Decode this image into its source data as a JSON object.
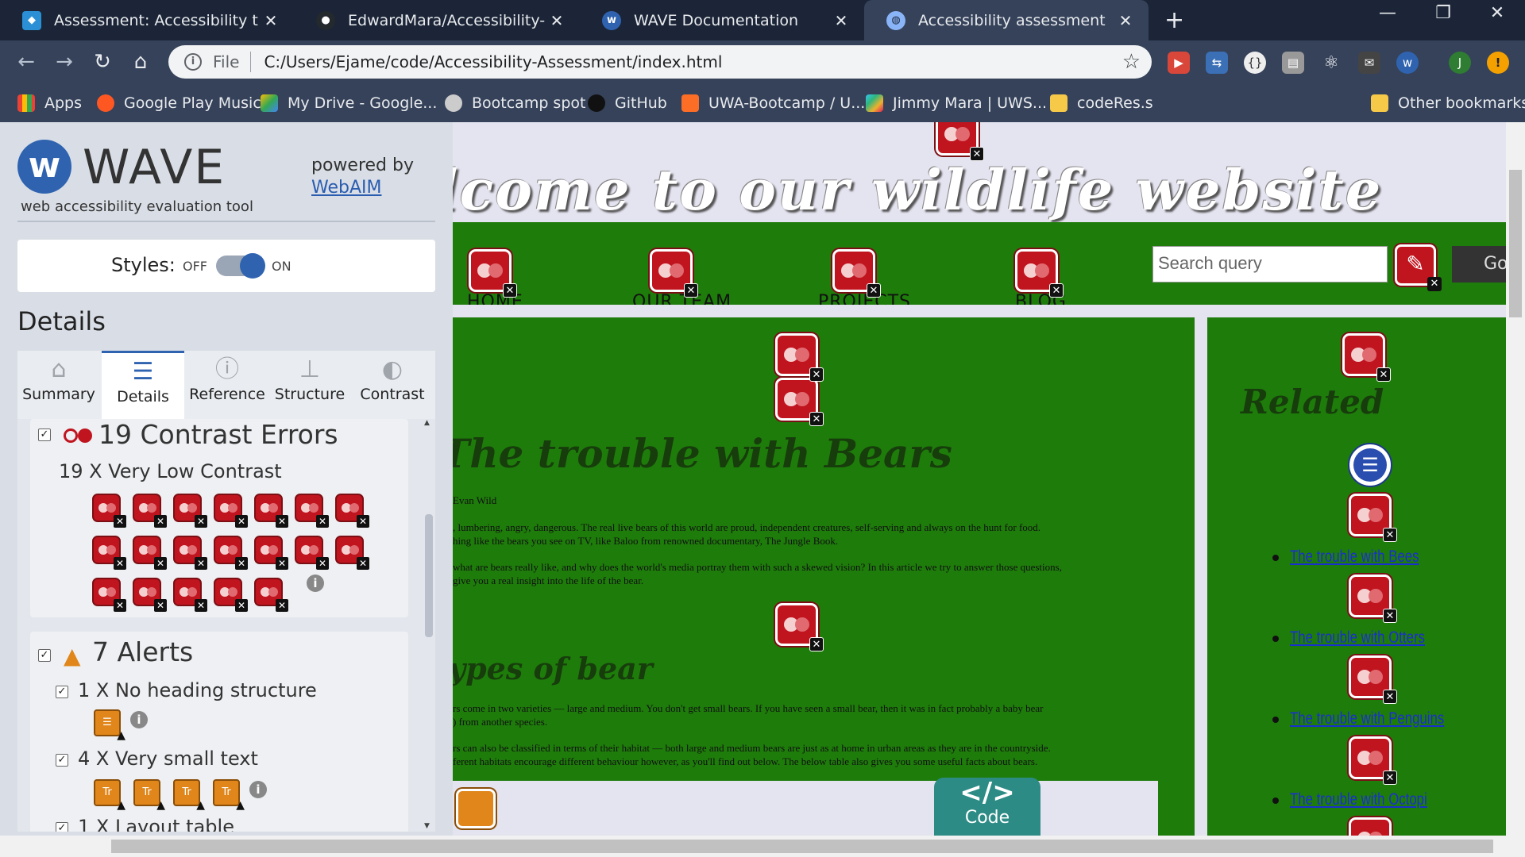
{
  "browser": {
    "tabs": [
      {
        "title": "Assessment: Accessibility trouble",
        "icon": "mdn-favicon",
        "color": "#2b8fd6"
      },
      {
        "title": "EdwardMara/Accessibility-Assess",
        "icon": "github-favicon",
        "color": "#24292e"
      },
      {
        "title": "WAVE Documentation",
        "icon": "wave-favicon",
        "color": "#2f63b0"
      },
      {
        "title": "Accessibility assessment",
        "icon": "globe-favicon",
        "color": "#8ab4f8"
      }
    ],
    "address": {
      "scheme_label": "File",
      "url": "C:/Users/Ejame/code/Accessibility-Assessment/index.html"
    },
    "profile_initial": "J",
    "bookmarks": [
      "Apps",
      "Google Play Music",
      "My Drive - Google...",
      "Bootcamp spot",
      "GitHub",
      "UWA-Bootcamp / U...",
      "Jimmy Mara | UWS...",
      "codeRes.s",
      "Other bookmarks"
    ]
  },
  "wave": {
    "title": "WAVE",
    "subtitle": "web accessibility evaluation tool",
    "powered_by": "powered by",
    "powered_link": "WebAIM",
    "styles_label": "Styles:",
    "off": "OFF",
    "on": "ON",
    "details_heading": "Details",
    "tabs": [
      "Summary",
      "Details",
      "Reference",
      "Structure",
      "Contrast"
    ],
    "contrast": {
      "title": "19 Contrast Errors",
      "sub": "19 X Very Low Contrast"
    },
    "alerts": {
      "title": "7 Alerts",
      "items": [
        "1 X No heading structure",
        "4 X Very small text",
        "1 X Layout table"
      ]
    },
    "small_text_icon_label": "Tr"
  },
  "page": {
    "banner": "lcome to our wildlife website",
    "nav": [
      "HOME",
      "OUR TEAM",
      "PROJECTS",
      "BLOG"
    ],
    "search_placeholder": "Search query",
    "go": "Go",
    "article_title": "The trouble with Bears",
    "byline": "Evan Wild",
    "p1a": ", lumbering, angry, dangerous. The real live bears of this world are proud, independent creatures, self-serving and always on the hunt for food.",
    "p1b": "hing like the bears you see on TV, like Baloo from renowned documentary, The Jungle Book.",
    "p2a": "what are bears really like, and why does the world's media portray them with such a skewed vision? In this article we try to answer those questions,",
    "p2b": "give you a real insight into the life of the bear.",
    "section_title": "ypes of bear",
    "p3a": "rs come in two varieties — large and medium. You don't get small bears. If you have seen a small bear, then it was in fact probably a baby bear",
    "p3b": ") from another species.",
    "p4a": "rs can also be classified in terms of their habitat — both large and medium bears are just as at home in urban areas as they are in the countryside.",
    "p4b": "ferent habitats encourage different behaviour however, as you'll find out below. The below table also gives you some useful facts about bears.",
    "code_label": "Code",
    "related_title": "Related",
    "related_links": [
      "The trouble with Bees",
      "The trouble with Otters",
      "The trouble with Penguins",
      "The trouble with Octopi"
    ]
  }
}
